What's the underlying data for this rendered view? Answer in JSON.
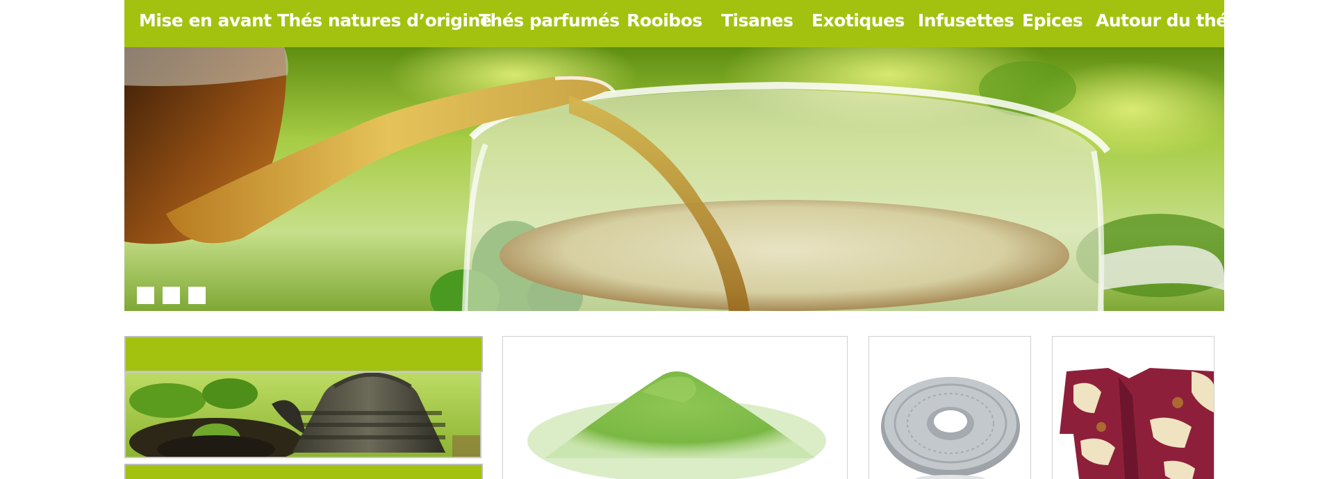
{
  "nav": {
    "items": [
      {
        "label": "Mise en avant"
      },
      {
        "label": "Thés natures d’origine"
      },
      {
        "label": "Thés parfumés"
      },
      {
        "label": "Rooibos"
      },
      {
        "label": "Tisanes"
      },
      {
        "label": "Exotiques"
      },
      {
        "label": "Infusettes"
      },
      {
        "label": "Epices"
      },
      {
        "label": "Autour du thé"
      }
    ]
  },
  "hero": {
    "slide_count": 3
  },
  "colors": {
    "brand_green": "#a3c20f",
    "white": "#ffffff"
  },
  "products": {
    "tiles": [
      {
        "icon": "matcha-powder-image"
      },
      {
        "icon": "cast-iron-trivet-image"
      },
      {
        "icon": "kimono-image"
      }
    ]
  }
}
